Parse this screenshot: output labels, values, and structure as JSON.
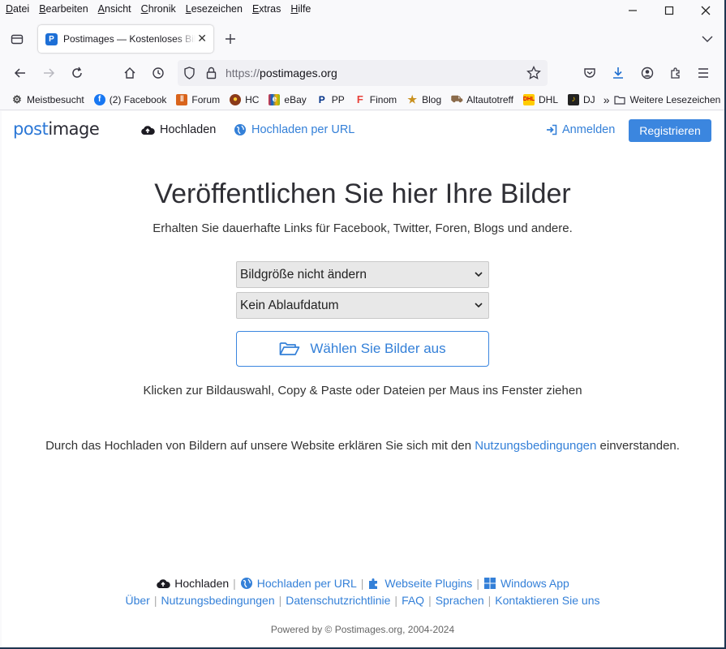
{
  "menu": [
    "Datei",
    "Bearbeiten",
    "Ansicht",
    "Chronik",
    "Lesezeichen",
    "Extras",
    "Hilfe"
  ],
  "tab": {
    "title": "Postimages — Kostenloses Bildhosting",
    "favicon": "P"
  },
  "url": {
    "scheme": "https://",
    "host": "postimages.org"
  },
  "bookmarks": [
    {
      "label": "Meistbesucht",
      "icon": "gear-icon"
    },
    {
      "label": "(2) Facebook",
      "icon": "facebook-icon"
    },
    {
      "label": "Forum",
      "icon": "forum-icon"
    },
    {
      "label": "HC",
      "icon": "hc-icon"
    },
    {
      "label": "eBay",
      "icon": "ebay-icon"
    },
    {
      "label": "PP",
      "icon": "paypal-icon"
    },
    {
      "label": "Finom",
      "icon": "finom-icon"
    },
    {
      "label": "Blog",
      "icon": "star-icon"
    },
    {
      "label": "Altautotreff",
      "icon": "car-icon"
    },
    {
      "label": "DHL",
      "icon": "dhl-icon"
    },
    {
      "label": "DJ",
      "icon": "dj-icon"
    }
  ],
  "bookmarks_more": "Weitere Lesezeichen",
  "header": {
    "logo_post": "post",
    "logo_image": "image",
    "upload": "Hochladen",
    "upload_url": "Hochladen per URL",
    "login": "Anmelden",
    "register": "Registrieren"
  },
  "main": {
    "headline": "Veröffentlichen Sie hier Ihre Bilder",
    "subline": "Erhalten Sie dauerhafte Links für Facebook, Twitter, Foren, Blogs und andere.",
    "resize_select": "Bildgröße nicht ändern",
    "expire_select": "Kein Ablaufdatum",
    "choose_button": "Wählen Sie Bilder aus",
    "hint": "Klicken zur Bildauswahl, Copy & Paste oder Dateien per Maus ins Fenster ziehen",
    "terms_before": "Durch das Hochladen von Bildern auf unsere Website erklären Sie sich mit den ",
    "terms_link": "Nutzungsbedingungen",
    "terms_after": " einverstanden."
  },
  "footer": {
    "upload": "Hochladen",
    "upload_url": "Hochladen per URL",
    "plugins": "Webseite Plugins",
    "windows_app": "Windows App",
    "about": "Über",
    "terms": "Nutzungsbedingungen",
    "privacy": "Datenschutzrichtlinie",
    "faq": "FAQ",
    "languages": "Sprachen",
    "contact": "Kontaktieren Sie uns",
    "copyright": "Powered by © Postimages.org, 2004-2024"
  },
  "colors": {
    "accent": "#3b86df",
    "link": "#3480d8"
  }
}
